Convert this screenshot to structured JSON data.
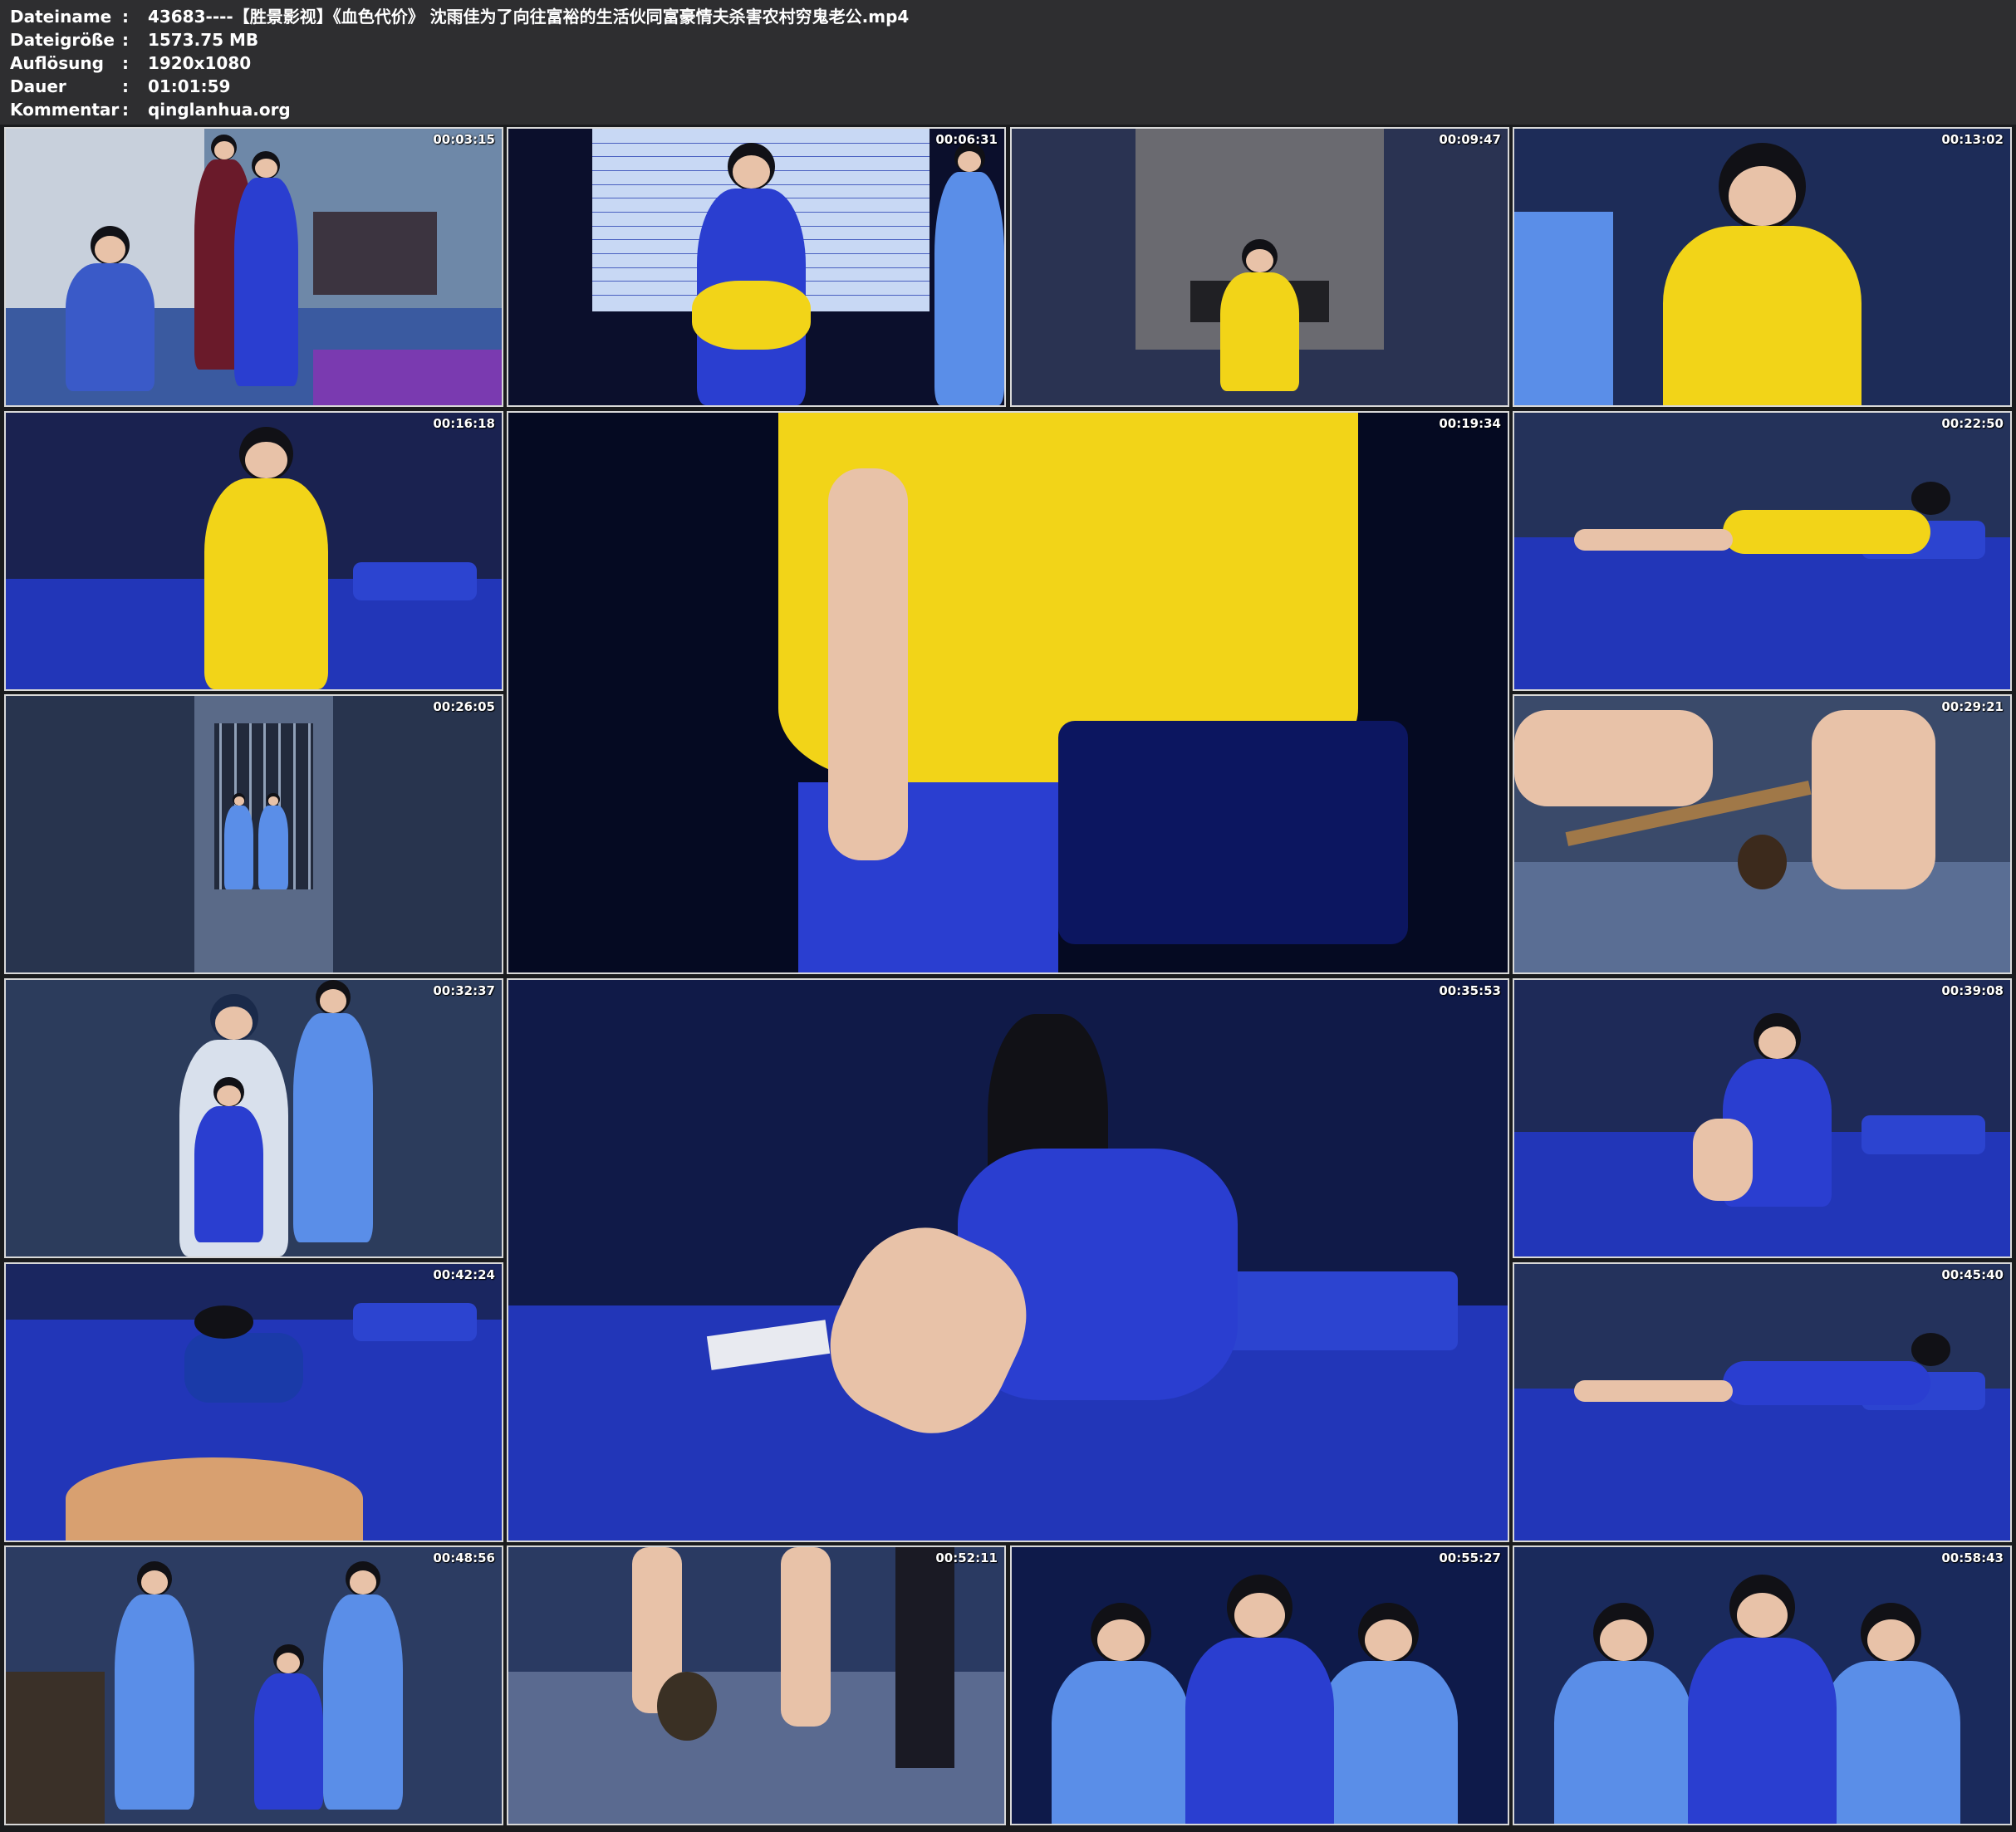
{
  "meta": {
    "rows": [
      {
        "label": "Dateiname",
        "colon": ":",
        "value": "43683----【胜景影视】《血色代价》 沈雨佳为了向往富裕的生活伙同富豪情夫杀害农村穷鬼老公.mp4"
      },
      {
        "label": "Dateigröße",
        "colon": ":",
        "value": "1573.75 MB"
      },
      {
        "label": "Auflösung",
        "colon": ":",
        "value": "1920x1080"
      },
      {
        "label": "Dauer",
        "colon": ":",
        "value": "01:01:59"
      },
      {
        "label": "Kommentar",
        "colon": ":",
        "value": "qinglanhua.org"
      }
    ]
  },
  "thumbnails": [
    {
      "timestamp": "00:03:15",
      "scene": "room",
      "bg": "#6e88a8"
    },
    {
      "timestamp": "00:06:31",
      "scene": "height-chart",
      "bg": "#0b0f2c"
    },
    {
      "timestamp": "00:09:47",
      "scene": "interrogation",
      "bg": "#2a3352"
    },
    {
      "timestamp": "00:13:02",
      "scene": "closeup-yellow",
      "bg": "#1d2c58"
    },
    {
      "timestamp": "00:16:18",
      "scene": "seated-yellow",
      "bg": "#1a2250"
    },
    {
      "timestamp": "00:19:34",
      "scene": "large-yellow",
      "bg": "#050a22"
    },
    {
      "timestamp": "00:22:50",
      "scene": "bed-lying",
      "bg": "#24325a"
    },
    {
      "timestamp": "00:26:05",
      "scene": "corridor",
      "bg": "#28344e"
    },
    {
      "timestamp": "00:29:21",
      "scene": "shackle",
      "bg": "#3a4a6a"
    },
    {
      "timestamp": "00:32:37",
      "scene": "officers",
      "bg": "#2c3c5c"
    },
    {
      "timestamp": "00:35:53",
      "scene": "large-bed",
      "bg": "#101a48"
    },
    {
      "timestamp": "00:39:08",
      "scene": "bed-sitting",
      "bg": "#1e2a58"
    },
    {
      "timestamp": "00:42:24",
      "scene": "bed-floor-view",
      "bg": "#1a2660"
    },
    {
      "timestamp": "00:45:40",
      "scene": "bed-lying-2",
      "bg": "#24325c"
    },
    {
      "timestamp": "00:48:56",
      "scene": "group-standing",
      "bg": "#2c3c62"
    },
    {
      "timestamp": "00:52:11",
      "scene": "feet-floor",
      "bg": "#2a3a62"
    },
    {
      "timestamp": "00:55:27",
      "scene": "group-front",
      "bg": "#0e1a4a"
    },
    {
      "timestamp": "00:58:43",
      "scene": "group-front-2",
      "bg": "#1a2a5c"
    }
  ],
  "colors": {
    "header_bg": "#2e2e30",
    "header_text": "#ffffff",
    "grid_bg": "#1a1b1d",
    "thumb_border": "#d8d8d8",
    "prison_yellow": "#f2d418",
    "prison_blue": "#2a3ed0",
    "police_blue": "#5a8ee8"
  }
}
